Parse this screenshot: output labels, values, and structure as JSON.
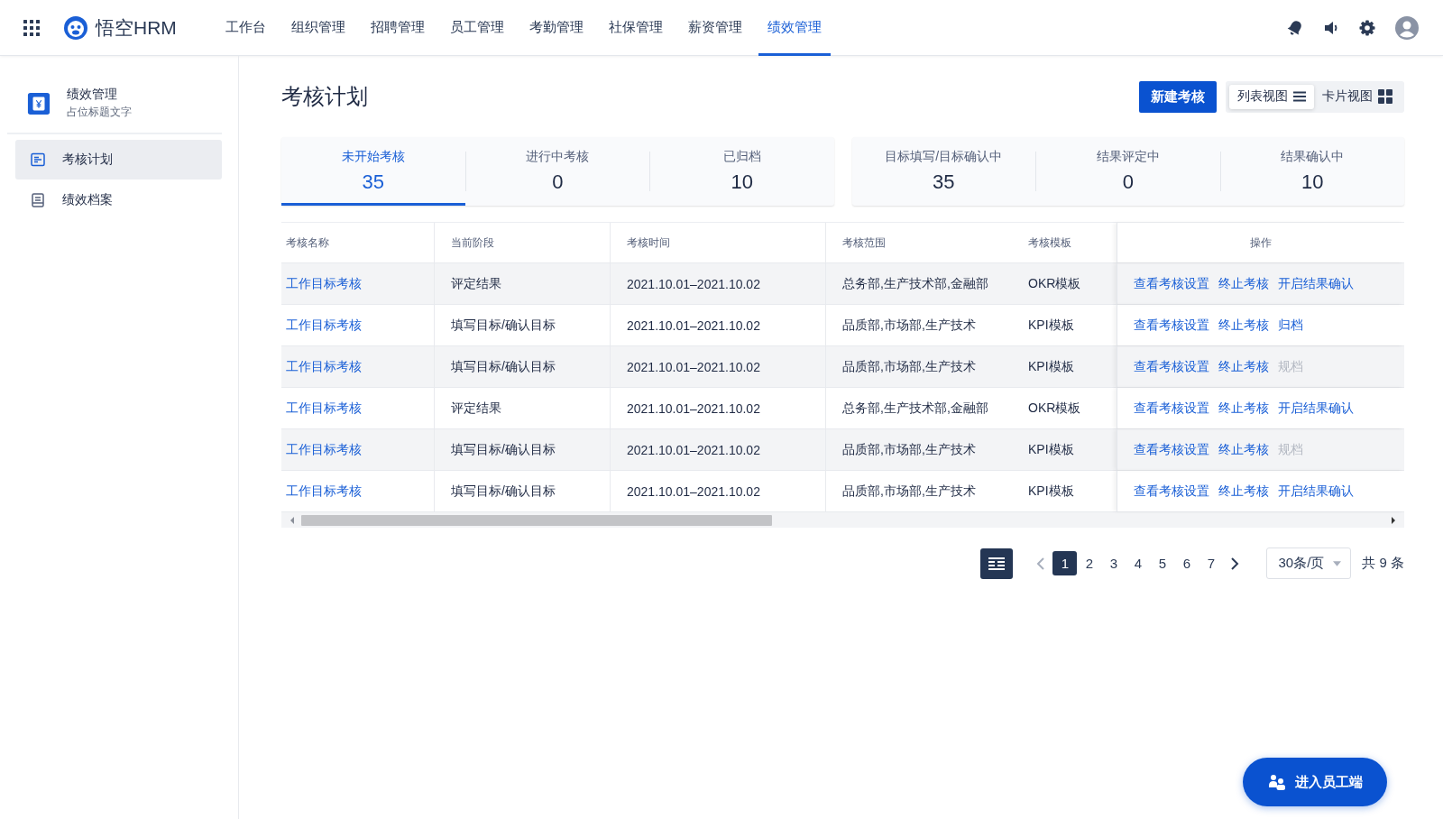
{
  "header": {
    "brand": "悟空HRM",
    "nav": [
      {
        "label": "工作台",
        "selected": false
      },
      {
        "label": "组织管理",
        "selected": false
      },
      {
        "label": "招聘管理",
        "selected": false
      },
      {
        "label": "员工管理",
        "selected": false
      },
      {
        "label": "考勤管理",
        "selected": false
      },
      {
        "label": "社保管理",
        "selected": false
      },
      {
        "label": "薪资管理",
        "selected": false
      },
      {
        "label": "绩效管理",
        "selected": true
      }
    ]
  },
  "sidebar": {
    "title": "绩效管理",
    "subtitle": "占位标题文字",
    "items": [
      {
        "label": "考核计划",
        "selected": true
      },
      {
        "label": "绩效档案",
        "selected": false
      }
    ]
  },
  "page_title": "考核计划",
  "new_button": "新建考核",
  "views": [
    {
      "label": "列表视图",
      "kind": "list",
      "selected": true
    },
    {
      "label": "卡片视图",
      "kind": "card",
      "selected": false
    }
  ],
  "status_tabs": [
    {
      "label": "未开始考核",
      "count": "35",
      "selected": true
    },
    {
      "label": "进行中考核",
      "count": "0",
      "selected": false
    },
    {
      "label": "已归档",
      "count": "10",
      "selected": false
    }
  ],
  "stage_stats": [
    {
      "label": "目标填写/目标确认中",
      "count": "35"
    },
    {
      "label": "结果评定中",
      "count": "0"
    },
    {
      "label": "结果确认中",
      "count": "10"
    }
  ],
  "table": {
    "columns": [
      "考核名称",
      "当前阶段",
      "考核时间",
      "考核范围",
      "考核模板",
      "操作"
    ],
    "rows": [
      {
        "name": "工作目标考核",
        "stage": "评定结果",
        "time": "2021.10.01–2021.10.02",
        "scope": "总务部,生产技术部,金融部",
        "template": "OKR模板",
        "actions": [
          {
            "label": "查看考核设置",
            "disabled": false
          },
          {
            "label": "终止考核",
            "disabled": false
          },
          {
            "label": "开启结果确认",
            "disabled": false
          }
        ]
      },
      {
        "name": "工作目标考核",
        "stage": "填写目标/确认目标",
        "time": "2021.10.01–2021.10.02",
        "scope": "品质部,市场部,生产技术",
        "template": "KPI模板",
        "actions": [
          {
            "label": "查看考核设置",
            "disabled": false
          },
          {
            "label": "终止考核",
            "disabled": false
          },
          {
            "label": "归档",
            "disabled": false
          }
        ]
      },
      {
        "name": "工作目标考核",
        "stage": "填写目标/确认目标",
        "time": "2021.10.01–2021.10.02",
        "scope": "品质部,市场部,生产技术",
        "template": "KPI模板",
        "actions": [
          {
            "label": "查看考核设置",
            "disabled": false
          },
          {
            "label": "终止考核",
            "disabled": false
          },
          {
            "label": "规档",
            "disabled": true
          }
        ]
      },
      {
        "name": "工作目标考核",
        "stage": "评定结果",
        "time": "2021.10.01–2021.10.02",
        "scope": "总务部,生产技术部,金融部",
        "template": "OKR模板",
        "actions": [
          {
            "label": "查看考核设置",
            "disabled": false
          },
          {
            "label": "终止考核",
            "disabled": false
          },
          {
            "label": "开启结果确认",
            "disabled": false
          }
        ]
      },
      {
        "name": "工作目标考核",
        "stage": "填写目标/确认目标",
        "time": "2021.10.01–2021.10.02",
        "scope": "品质部,市场部,生产技术",
        "template": "KPI模板",
        "actions": [
          {
            "label": "查看考核设置",
            "disabled": false
          },
          {
            "label": "终止考核",
            "disabled": false
          },
          {
            "label": "规档",
            "disabled": true
          }
        ]
      },
      {
        "name": "工作目标考核",
        "stage": "填写目标/确认目标",
        "time": "2021.10.01–2021.10.02",
        "scope": "品质部,市场部,生产技术",
        "template": "KPI模板",
        "actions": [
          {
            "label": "查看考核设置",
            "disabled": false
          },
          {
            "label": "终止考核",
            "disabled": false
          },
          {
            "label": "开启结果确认",
            "disabled": false
          }
        ]
      }
    ]
  },
  "pagination": {
    "pages": [
      {
        "label": "1",
        "selected": true
      },
      {
        "label": "2",
        "selected": false
      },
      {
        "label": "3",
        "selected": false
      },
      {
        "label": "4",
        "selected": false
      },
      {
        "label": "5",
        "selected": false
      },
      {
        "label": "6",
        "selected": false
      },
      {
        "label": "7",
        "selected": false
      }
    ],
    "page_size": "30条/页",
    "total": "共 9 条"
  },
  "float_button": "进入员工端"
}
